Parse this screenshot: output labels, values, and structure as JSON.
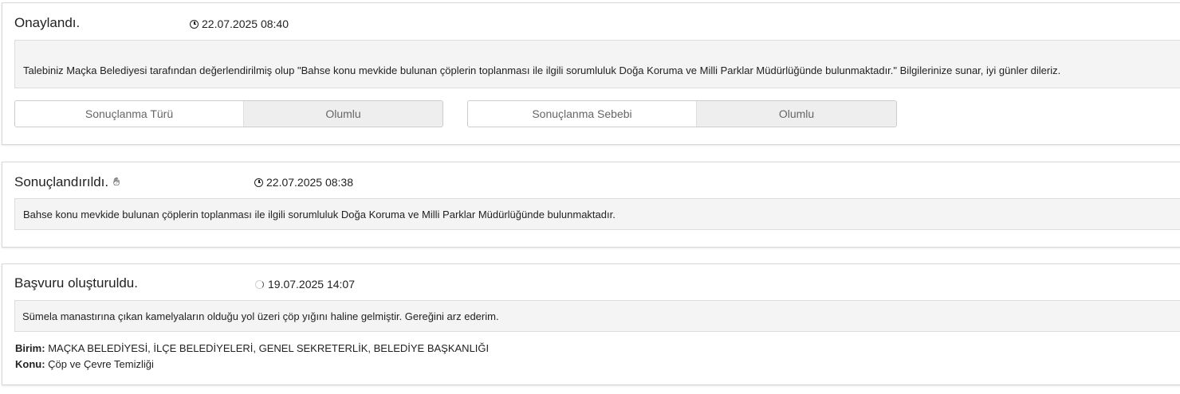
{
  "entries": [
    {
      "title": "Onaylandı.",
      "timestamp": "22.07.2025 08:40",
      "message": "Talebiniz Maçka Belediyesi tarafından değerlendirilmiş olup \"Bahse konu mevkide bulunan çöplerin toplanması ile ilgili sorumluluk Doğa Koruma ve Milli Parklar Müdürlüğünde bulunmaktadır.\" Bilgilerinize sunar, iyi günler dileriz.",
      "result_type_label": "Sonuçlanma Türü",
      "result_type_value": "Olumlu",
      "result_reason_label": "Sonuçlanma Sebebi",
      "result_reason_value": "Olumlu"
    },
    {
      "title": "Sonuçlandırıldı.",
      "icon": "hand-icon",
      "timestamp": "22.07.2025 08:38",
      "message": "Bahse konu mevkide bulunan çöplerin toplanması ile ilgili sorumluluk Doğa Koruma ve Milli Parklar Müdürlüğünde bulunmaktadır."
    },
    {
      "title": "Başvuru oluşturuldu.",
      "icon": "spinner-icon",
      "timestamp": "19.07.2025 14:07",
      "message": "Sümela manastırına çıkan kamelyaların olduğu yol üzeri çöp yığını haline gelmiştir. Gereğini arz ederim.",
      "birim_label": "Birim:",
      "birim_value": "MAÇKA BELEDİYESİ, İLÇE BELEDİYELERİ, GENEL SEKRETERLİK, BELEDİYE BAŞKANLIĞI",
      "konu_label": "Konu:",
      "konu_value": "Çöp ve Çevre Temizliği"
    }
  ],
  "colors": {
    "card_border": "#d8d8d8",
    "message_background": "#f4f4f4",
    "result_value_background": "#eeeeee",
    "text": "#222222",
    "muted_text": "#666666"
  }
}
